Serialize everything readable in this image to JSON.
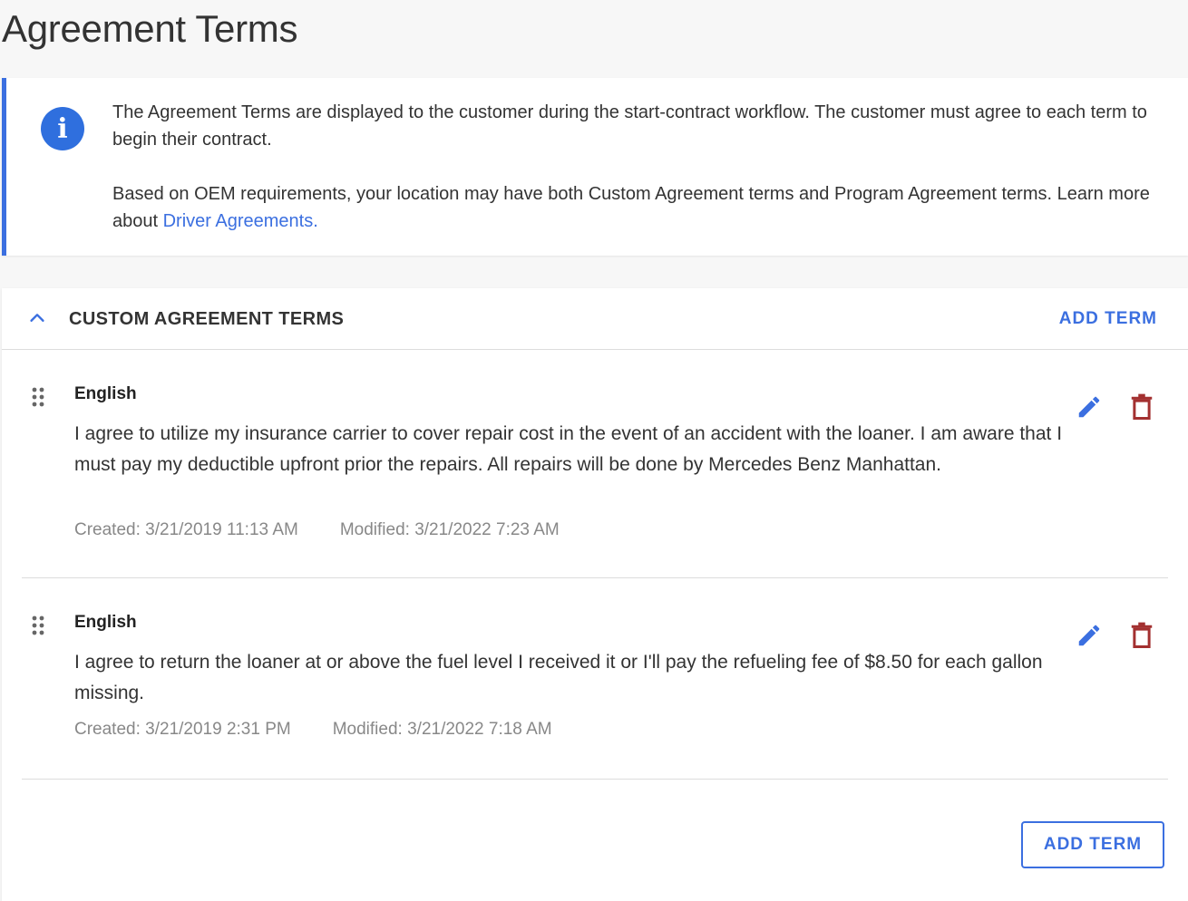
{
  "page": {
    "title": "Agreement Terms"
  },
  "info": {
    "paragraph1": "The Agreement Terms are displayed to the customer during the start-contract workflow. The customer must agree to each term to begin their contract.",
    "paragraph2_prefix": "Based on OEM requirements, your location may have both Custom Agreement terms and Program Agreement terms. Learn more about ",
    "link_text": "Driver Agreements."
  },
  "section": {
    "title": "CUSTOM AGREEMENT TERMS",
    "add_term_label": "ADD TERM"
  },
  "terms": [
    {
      "language": "English",
      "text": "I agree to utilize my insurance carrier to cover repair cost in the event of an accident with the loaner. I am aware that I must pay my deductible upfront prior the repairs. All repairs will be done by Mercedes Benz Manhattan.",
      "created": "Created: 3/21/2019 11:13 AM",
      "modified": "Modified: 3/21/2022 7:23 AM"
    },
    {
      "language": "English",
      "text": "I agree to return the loaner at or above the fuel level I received it or I'll pay the refueling fee of $8.50 for each gallon missing.",
      "created": "Created: 3/21/2019 2:31 PM",
      "modified": "Modified: 3/21/2022 7:18 AM"
    }
  ],
  "footer": {
    "add_term_button": "ADD TERM"
  },
  "colors": {
    "accent": "#3b6fe0",
    "delete": "#a33030",
    "muted": "#888888"
  }
}
